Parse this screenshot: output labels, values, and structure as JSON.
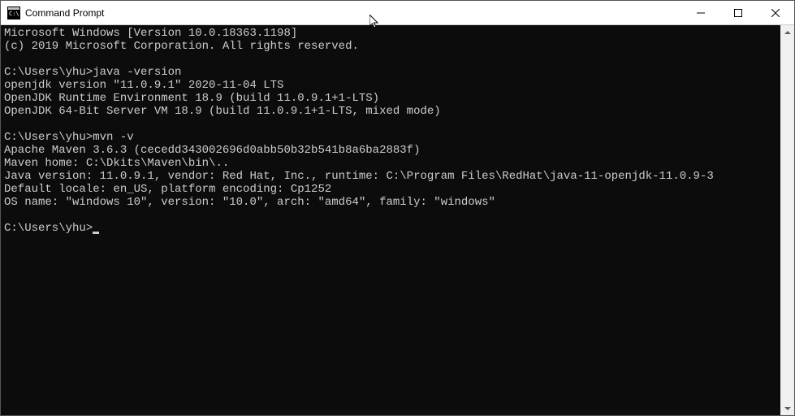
{
  "window": {
    "title": "Command Prompt"
  },
  "terminal": {
    "lines": [
      "Microsoft Windows [Version 10.0.18363.1198]",
      "(c) 2019 Microsoft Corporation. All rights reserved.",
      "",
      "C:\\Users\\yhu>java -version",
      "openjdk version \"11.0.9.1\" 2020-11-04 LTS",
      "OpenJDK Runtime Environment 18.9 (build 11.0.9.1+1-LTS)",
      "OpenJDK 64-Bit Server VM 18.9 (build 11.0.9.1+1-LTS, mixed mode)",
      "",
      "C:\\Users\\yhu>mvn -v",
      "Apache Maven 3.6.3 (cecedd343002696d0abb50b32b541b8a6ba2883f)",
      "Maven home: C:\\Dkits\\Maven\\bin\\..",
      "Java version: 11.0.9.1, vendor: Red Hat, Inc., runtime: C:\\Program Files\\RedHat\\java-11-openjdk-11.0.9-3",
      "Default locale: en_US, platform encoding: Cp1252",
      "OS name: \"windows 10\", version: \"10.0\", arch: \"amd64\", family: \"windows\"",
      ""
    ],
    "prompt": "C:\\Users\\yhu>"
  }
}
